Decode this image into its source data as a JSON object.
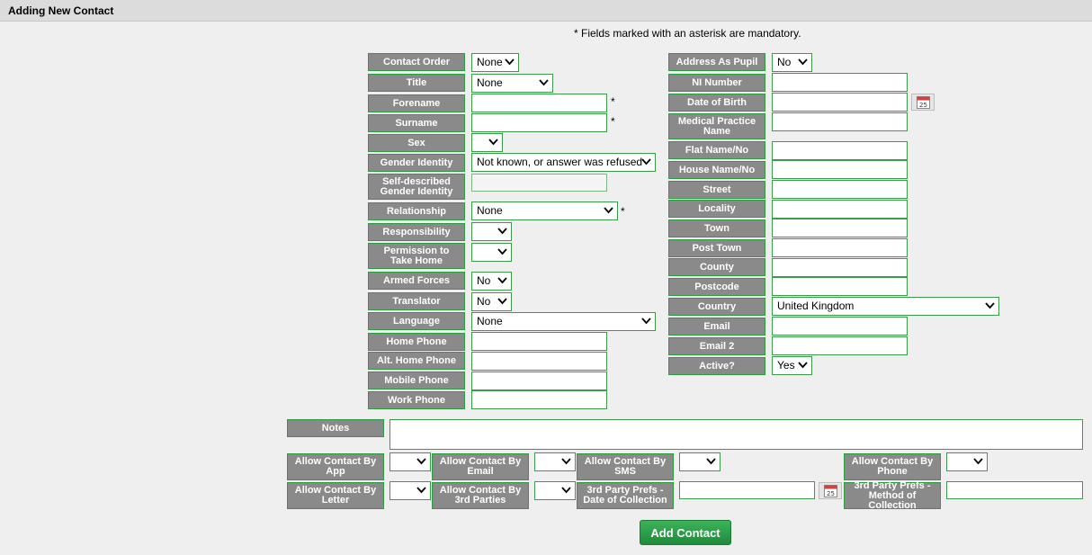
{
  "header": {
    "title": "Adding New Contact"
  },
  "notice": "* Fields marked with an asterisk are mandatory.",
  "asterisk": "*",
  "left": {
    "contact_order": {
      "label": "Contact Order",
      "value": "None"
    },
    "title": {
      "label": "Title",
      "value": "None"
    },
    "forename": {
      "label": "Forename",
      "value": ""
    },
    "surname": {
      "label": "Surname",
      "value": ""
    },
    "sex": {
      "label": "Sex",
      "value": ""
    },
    "gender_identity": {
      "label": "Gender Identity",
      "value": "Not known, or answer was refused"
    },
    "self_described": {
      "label": "Self-described Gender Identity",
      "value": ""
    },
    "relationship": {
      "label": "Relationship",
      "value": "None"
    },
    "responsibility": {
      "label": "Responsibility",
      "value": ""
    },
    "permission": {
      "label": "Permission to Take Home",
      "value": ""
    },
    "armed_forces": {
      "label": "Armed Forces",
      "value": "No"
    },
    "translator": {
      "label": "Translator",
      "value": "No"
    },
    "language": {
      "label": "Language",
      "value": "None"
    },
    "home_phone": {
      "label": "Home Phone",
      "value": ""
    },
    "alt_home_phone": {
      "label": "Alt. Home Phone",
      "value": ""
    },
    "mobile_phone": {
      "label": "Mobile Phone",
      "value": ""
    },
    "work_phone": {
      "label": "Work Phone",
      "value": ""
    }
  },
  "right": {
    "address_as_pupil": {
      "label": "Address As Pupil",
      "value": "No"
    },
    "ni_number": {
      "label": "NI Number",
      "value": ""
    },
    "dob": {
      "label": "Date of Birth",
      "value": ""
    },
    "medical_practice": {
      "label": "Medical Practice Name",
      "value": ""
    },
    "flat": {
      "label": "Flat Name/No",
      "value": ""
    },
    "house": {
      "label": "House Name/No",
      "value": ""
    },
    "street": {
      "label": "Street",
      "value": ""
    },
    "locality": {
      "label": "Locality",
      "value": ""
    },
    "town": {
      "label": "Town",
      "value": ""
    },
    "post_town": {
      "label": "Post Town",
      "value": ""
    },
    "county": {
      "label": "County",
      "value": ""
    },
    "postcode": {
      "label": "Postcode",
      "value": ""
    },
    "country": {
      "label": "Country",
      "value": "United Kingdom"
    },
    "email": {
      "label": "Email",
      "value": ""
    },
    "email2": {
      "label": "Email 2",
      "value": ""
    },
    "active": {
      "label": "Active?",
      "value": "Yes"
    }
  },
  "bottom": {
    "notes": {
      "label": "Notes",
      "value": ""
    },
    "allow_app": {
      "label": "Allow Contact By App",
      "value": ""
    },
    "allow_email": {
      "label": "Allow Contact By Email",
      "value": ""
    },
    "allow_sms": {
      "label": "Allow Contact By SMS",
      "value": ""
    },
    "allow_phone": {
      "label": "Allow Contact By Phone",
      "value": ""
    },
    "allow_letter": {
      "label": "Allow Contact By Letter",
      "value": ""
    },
    "allow_3rd": {
      "label": "Allow Contact By 3rd Parties",
      "value": ""
    },
    "third_date": {
      "label": "3rd Party Prefs - Date of Collection",
      "value": ""
    },
    "third_method": {
      "label": "3rd Party Prefs - Method of Collection",
      "value": ""
    }
  },
  "actions": {
    "add_label": "Add Contact"
  },
  "icons": {
    "calendar": "calendar-icon",
    "dropdown": "chevron-down-icon"
  },
  "colors": {
    "label_bg": "#8a8a8a",
    "field_border": "#3b9b4b",
    "button": "#2a9e48"
  }
}
